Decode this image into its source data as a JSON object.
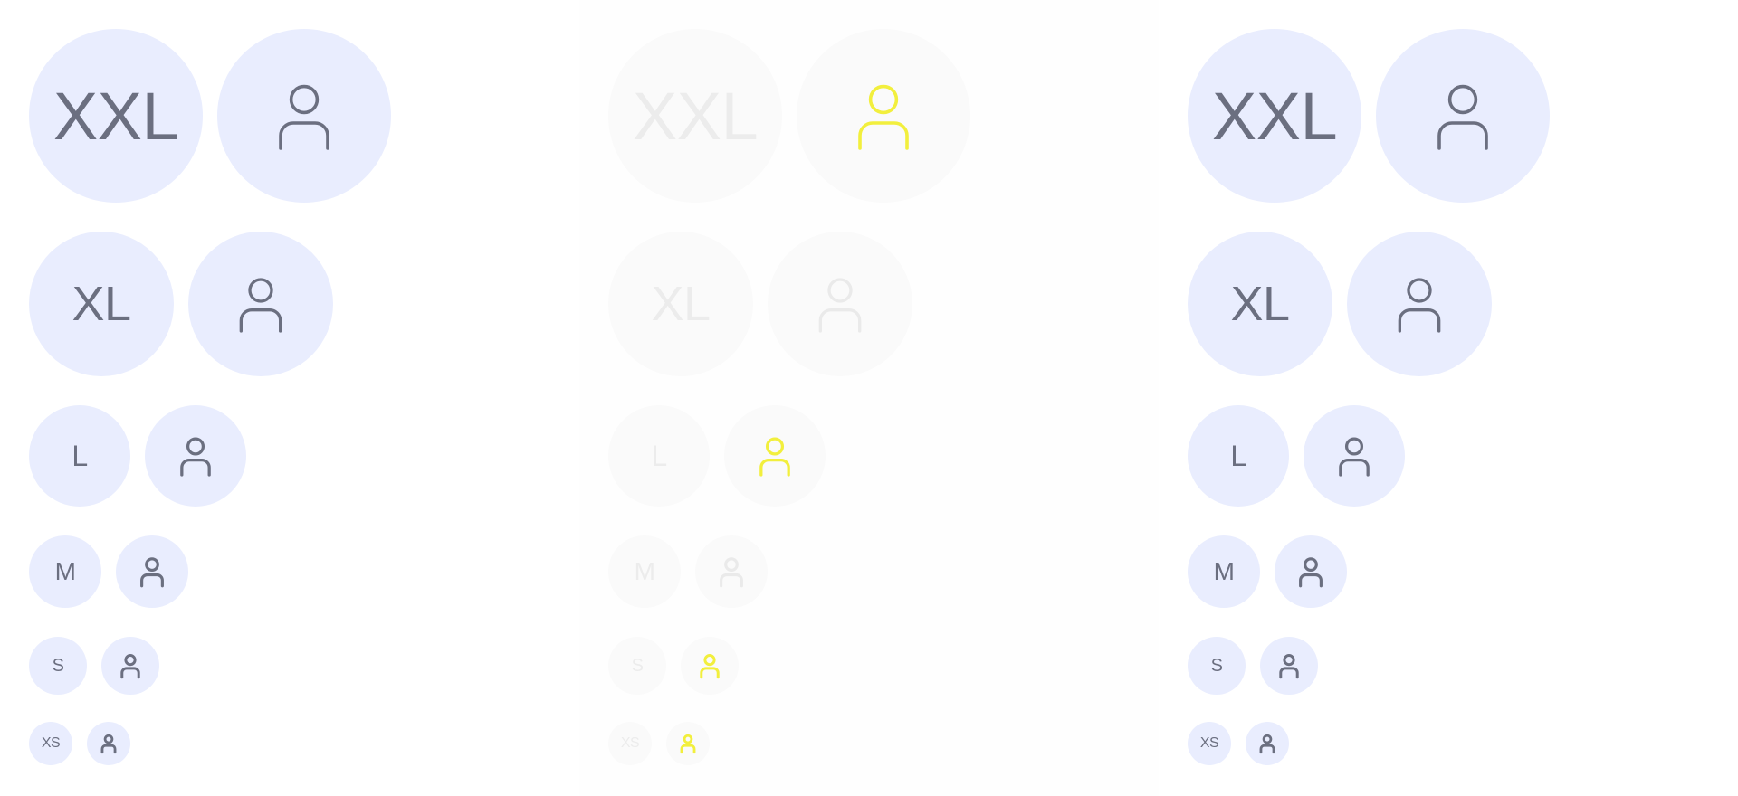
{
  "panels": [
    {
      "id": "panel-1",
      "state": "normal",
      "rows": [
        {
          "size": "XXL",
          "initials": "XXL",
          "icon": "user-icon"
        },
        {
          "size": "XL",
          "initials": "XL",
          "icon": "user-icon"
        },
        {
          "size": "L",
          "initials": "L",
          "icon": "user-icon"
        },
        {
          "size": "M",
          "initials": "M",
          "icon": "user-icon"
        },
        {
          "size": "S",
          "initials": "S",
          "icon": "user-icon"
        },
        {
          "size": "XS",
          "initials": "XS",
          "icon": "user-icon"
        }
      ]
    },
    {
      "id": "panel-2",
      "state": "faded",
      "rows": [
        {
          "size": "XXL",
          "initials": "XXL",
          "icon": "user-icon",
          "icon_highlighted": true
        },
        {
          "size": "XL",
          "initials": "XL",
          "icon": "user-icon",
          "icon_highlighted": false
        },
        {
          "size": "L",
          "initials": "L",
          "icon": "user-icon",
          "icon_highlighted": true
        },
        {
          "size": "M",
          "initials": "M",
          "icon": "user-icon",
          "icon_highlighted": false
        },
        {
          "size": "S",
          "initials": "S",
          "icon": "user-icon",
          "icon_highlighted": true
        },
        {
          "size": "XS",
          "initials": "XS",
          "icon": "user-icon",
          "icon_highlighted": true
        }
      ]
    },
    {
      "id": "panel-3",
      "state": "normal",
      "rows": [
        {
          "size": "XXL",
          "initials": "XXL",
          "icon": "user-icon"
        },
        {
          "size": "XL",
          "initials": "XL",
          "icon": "user-icon"
        },
        {
          "size": "L",
          "initials": "L",
          "icon": "user-icon"
        },
        {
          "size": "M",
          "initials": "M",
          "icon": "user-icon"
        },
        {
          "size": "S",
          "initials": "S",
          "icon": "user-icon"
        },
        {
          "size": "XS",
          "initials": "XS",
          "icon": "user-icon"
        }
      ]
    }
  ],
  "colors": {
    "avatar_bg": "#e9edfe",
    "avatar_fg": "#6b6f80",
    "faded_bg": "#fafafa",
    "faded_fg": "#ececec",
    "highlight": "#f2ef3d"
  }
}
